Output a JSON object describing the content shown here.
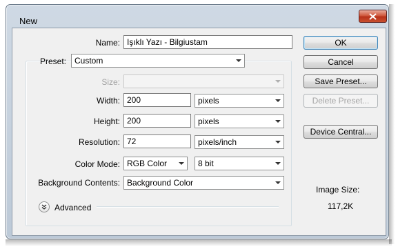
{
  "window": {
    "title": "New"
  },
  "form": {
    "name_label": "Name:",
    "name_value": "Işıklı Yazı - Bilgiustam",
    "preset_label": "Preset:",
    "preset_value": "Custom",
    "size_label": "Size:",
    "size_value": "",
    "width_label": "Width:",
    "width_value": "200",
    "width_unit": "pixels",
    "height_label": "Height:",
    "height_value": "200",
    "height_unit": "pixels",
    "resolution_label": "Resolution:",
    "resolution_value": "72",
    "resolution_unit": "pixels/inch",
    "color_mode_label": "Color Mode:",
    "color_mode_value": "RGB Color",
    "bit_depth_value": "8 bit",
    "background_label": "Background Contents:",
    "background_value": "Background Color",
    "advanced_label": "Advanced"
  },
  "buttons": {
    "ok": "OK",
    "cancel": "Cancel",
    "save_preset": "Save Preset...",
    "delete_preset": "Delete Preset...",
    "device_central": "Device Central..."
  },
  "image_size": {
    "label": "Image Size:",
    "value": "117,2K"
  },
  "icons": {
    "close": "close-icon",
    "dropdown": "chevron-down-icon",
    "advanced": "double-chevron-down-icon"
  },
  "colors": {
    "close_button": "#c9502f",
    "frame": "#bcc9d7",
    "client": "#f0f0f0"
  }
}
